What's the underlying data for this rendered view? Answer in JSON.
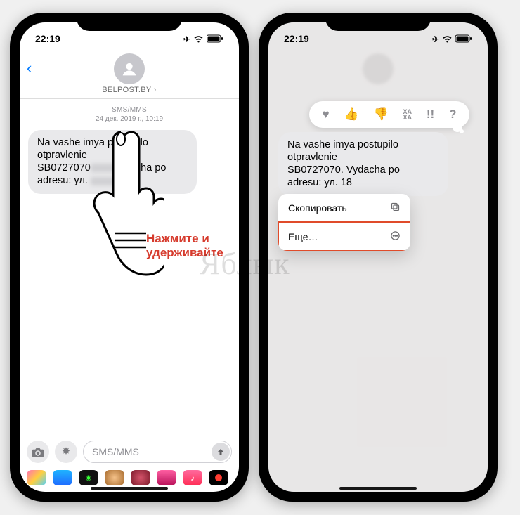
{
  "status": {
    "time": "22:19"
  },
  "left": {
    "contact": "BELPOST.BY",
    "conv_type": "SMS/MMS",
    "timestamp": "24 дек. 2019 г., 10:19",
    "message_l1": "Na vashe imya postupilo otpravlenie",
    "message_l2a": "SB0727070",
    "message_l2b": "dacha po",
    "message_l3a": "adresu: ул.",
    "message_l3b": " 18",
    "input_placeholder": "SMS/MMS"
  },
  "right": {
    "message_l1": "Na vashe imya postupilo otpravlenie",
    "message_l2a": "SB0727070",
    "message_l2b": ". Vydacha po",
    "message_l3a": "adresu: ул.",
    "message_l3b": " 18",
    "tapback": {
      "heart": "♥",
      "up": "👍",
      "down": "👎",
      "haha": "ХА\nХА",
      "bang": "!!",
      "q": "?"
    },
    "menu": {
      "copy": "Скопировать",
      "more": "Еще…"
    }
  },
  "instruction_l1": "Нажмите и",
  "instruction_l2": "удерживайте",
  "watermark": "Яблык",
  "app_colors": [
    "#ff3b7b",
    "#1f8bff",
    "#0a0a0a",
    "#c96b2a",
    "#b0243a",
    "#f93a9a",
    "#ff008c",
    "#000"
  ]
}
